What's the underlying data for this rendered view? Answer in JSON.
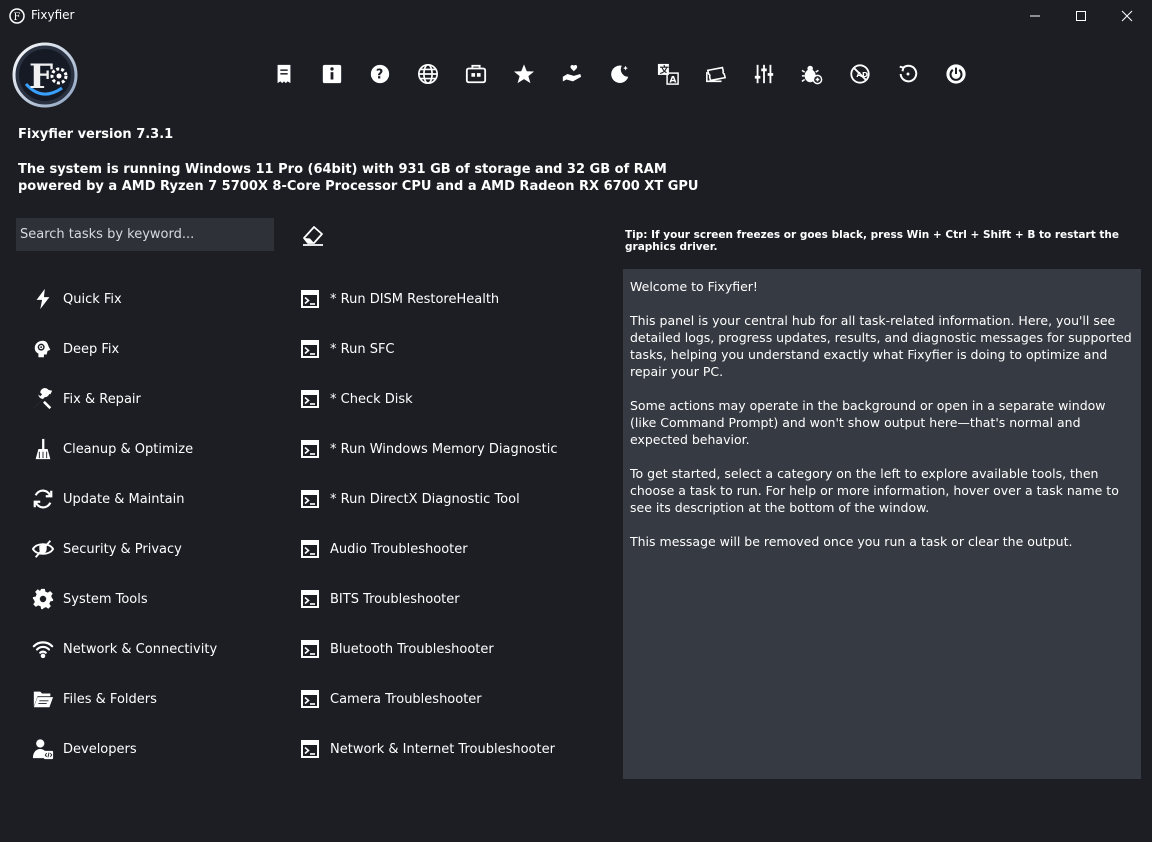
{
  "window": {
    "title": "Fixyfier"
  },
  "header": {
    "version": "Fixyfier version 7.3.1",
    "sysinfo_line1": "The system is running Windows 11 Pro (64bit) with 931 GB of storage and 32 GB of RAM",
    "sysinfo_line2": "powered by a AMD Ryzen 7 5700X 8-Core Processor CPU and a AMD Radeon RX 6700 XT GPU"
  },
  "toolbar": {
    "icons": [
      "document-icon",
      "info-icon",
      "help-icon",
      "globe-icon",
      "toolbox-icon",
      "star-icon",
      "donate-hand-icon",
      "moon-icon",
      "translate-icon",
      "tickets-icon",
      "sliders-icon",
      "bug-icon",
      "block-icon",
      "restart-icon",
      "power-icon"
    ]
  },
  "search": {
    "placeholder": "Search tasks by keyword..."
  },
  "tip": "Tip: If your screen freezes or goes black, press Win + Ctrl + Shift + B to restart the graphics driver.",
  "categories": [
    {
      "label": "Quick Fix",
      "icon": "lightning-icon"
    },
    {
      "label": "Deep Fix",
      "icon": "brain-gear-icon"
    },
    {
      "label": "Fix & Repair",
      "icon": "wrench-screwdriver-icon"
    },
    {
      "label": "Cleanup & Optimize",
      "icon": "broom-icon"
    },
    {
      "label": "Update & Maintain",
      "icon": "refresh-icon"
    },
    {
      "label": "Security & Privacy",
      "icon": "eye-shield-icon"
    },
    {
      "label": "System Tools",
      "icon": "gear-icon"
    },
    {
      "label": "Network & Connectivity",
      "icon": "wifi-icon"
    },
    {
      "label": "Files & Folders",
      "icon": "folder-icon"
    },
    {
      "label": "Developers",
      "icon": "developer-icon"
    }
  ],
  "tasks": [
    "* Run DISM RestoreHealth",
    "* Run SFC",
    "* Check Disk",
    "* Run Windows Memory Diagnostic",
    "* Run DirectX Diagnostic Tool",
    "Audio Troubleshooter",
    "BITS Troubleshooter",
    "Bluetooth Troubleshooter",
    "Camera Troubleshooter",
    "Network & Internet Troubleshooter"
  ],
  "output": {
    "p1": "Welcome to Fixyfier!",
    "p2": "This panel is your central hub for all task-related information. Here, you'll see detailed logs, progress updates, results, and diagnostic messages for supported tasks, helping you understand exactly what Fixyfier is doing to optimize and repair your PC.",
    "p3": "Some actions may operate in the background or open in a separate window (like Command Prompt) and won't show output here—that's normal and expected behavior.",
    "p4": "To get started, select a category on the left to explore available tools, then choose a task to run. For help or more information, hover over a task name to see its description at the bottom of the window.",
    "p5": "This message will be removed once you run a task or clear the output."
  },
  "colors": {
    "background": "#1c1e24",
    "panel": "#363a42",
    "input": "#2e3138",
    "text": "#ffffff"
  }
}
